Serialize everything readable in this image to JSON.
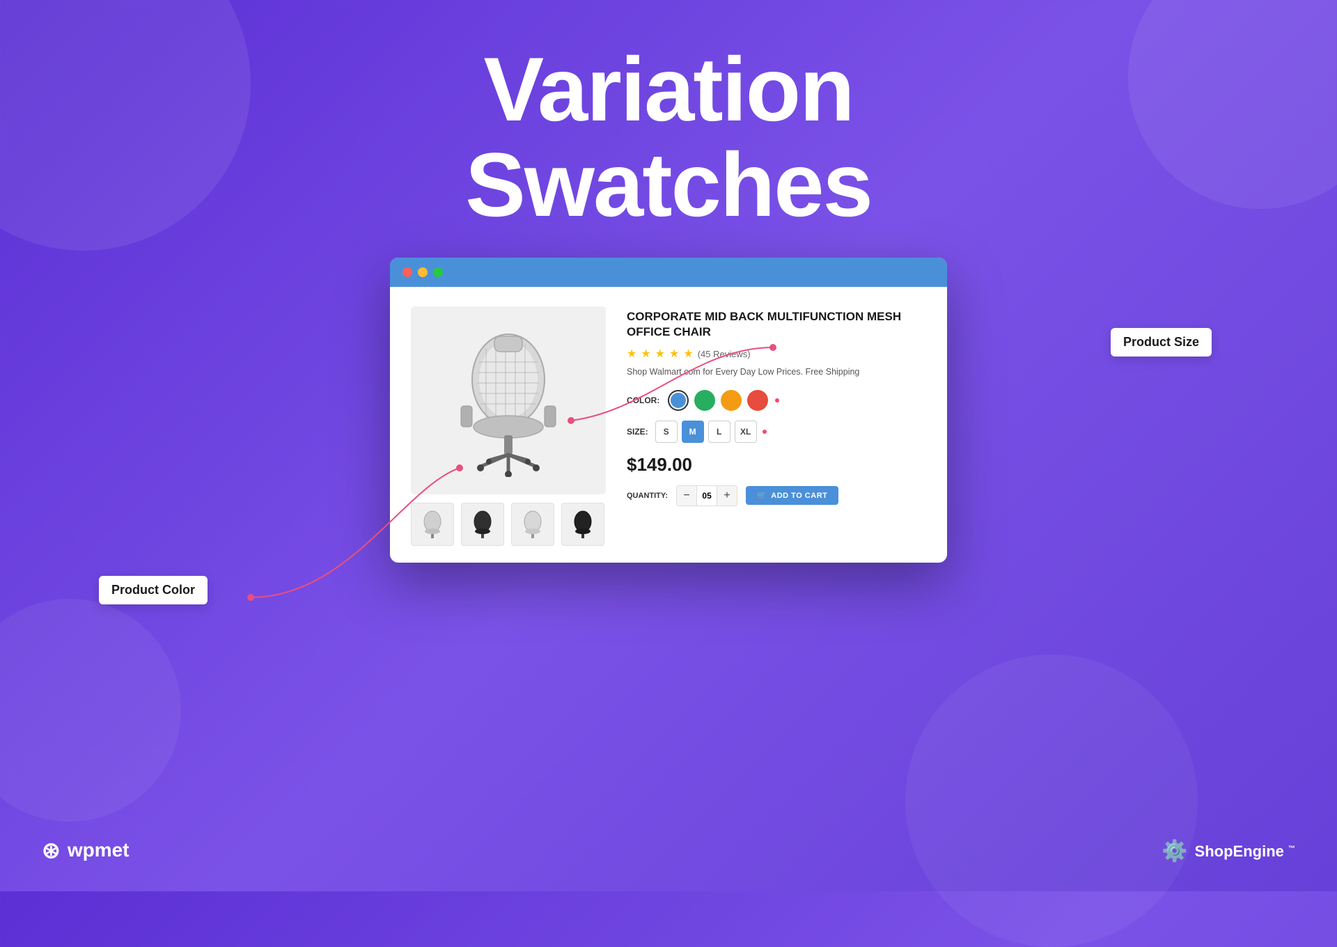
{
  "page": {
    "bg_color": "#6640d8",
    "title_line1": "Variation",
    "title_line2": "Swatches"
  },
  "browser": {
    "titlebar_color": "#4a90d9",
    "dots": [
      "#ff5f57",
      "#febc2e",
      "#28c840"
    ]
  },
  "product": {
    "title": "CORPORATE MID BACK MULTIFUNCTION MESH OFFICE CHAIR",
    "rating": 5,
    "reviews": "(45 Reviews)",
    "description": "Shop Walmart.com for Every Day Low Prices. Free Shipping",
    "color_label": "COLOR:",
    "colors": [
      {
        "name": "blue",
        "hex": "#4a90d9",
        "active": true
      },
      {
        "name": "green",
        "hex": "#27ae60",
        "active": false
      },
      {
        "name": "orange",
        "hex": "#f39c12",
        "active": false
      },
      {
        "name": "red",
        "hex": "#e74c3c",
        "active": false
      }
    ],
    "size_label": "SIZE:",
    "sizes": [
      "S",
      "M",
      "L",
      "XL"
    ],
    "active_size": "M",
    "price": "$149.00",
    "quantity_label": "QUANTITY:",
    "quantity": "05",
    "add_to_cart_label": "ADD TO CART"
  },
  "callouts": {
    "product_color": "Product Color",
    "product_size": "Product Size"
  },
  "footer": {
    "left_logo": "wpmet",
    "right_logo": "ShopEngine"
  }
}
